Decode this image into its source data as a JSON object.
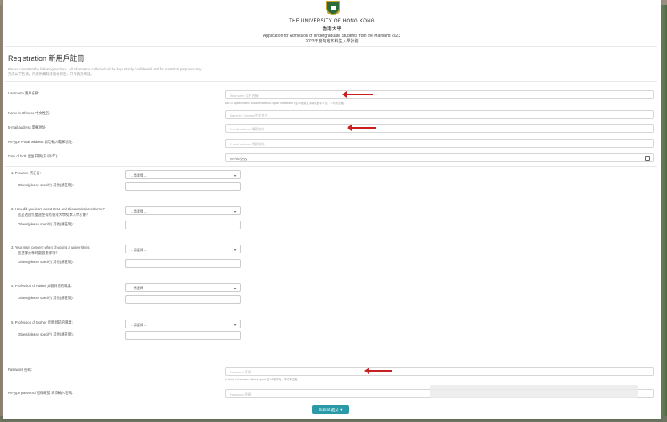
{
  "header": {
    "university": "THE UNIVERSITY OF HONG KONG",
    "university_zh": "香港大學",
    "application_title": "Application for Admission of Undergraduate Students from the Mainland 2023",
    "application_title_zh": "2023年度內地本科生入學計劃"
  },
  "form": {
    "title": "Registration 新用戶註冊",
    "intro_en": "Please complete the following sections. All information collected will be kept strictly confidential and for statistical purposes only.",
    "intro_zh": "完成以下各項，所提供資料將嚴格保密，只作統計用途。",
    "username": {
      "label": "Username 用戶名稱:",
      "placeholder": "Username 用戶名稱",
      "hint": "6 to 20 alphanumeric characters without space in-between 6至20個英文字母或數字字元，不可有空格。"
    },
    "name_chinese": {
      "label": "Name in Chinese 中文姓名:",
      "placeholder": "Name in Chinese 中文姓名"
    },
    "email": {
      "label": "E-mail address 電郵地址:",
      "placeholder": "E-mail address 電郵地址"
    },
    "email_retype": {
      "label": "Re-type e-mail address 再次輸入電郵地址:",
      "placeholder": "E-mail address 電郵地址"
    },
    "dob": {
      "label": "Date of birth 出生日期 (日/月/年):",
      "placeholder": "mm/dd/yyyy"
    },
    "select_placeholder": "-- 請選擇 --",
    "others_label": "Others(please specify) 其他(請註明):",
    "questions": [
      {
        "label": "1.  Province 所在省:"
      },
      {
        "label": "2.  How did you learn about HKU and this admission scheme?",
        "label_zh": "您是透過什麼途徑得悉香港大學及本入學計劃？"
      },
      {
        "label": "3.  Your main concern when choosing a university is:",
        "label_zh": "您選擇大學時最著重哪項？"
      },
      {
        "label": "4.  Profession of Father 父親目前的職業:"
      },
      {
        "label": "5.  Profession of Mother 母親目前的職業:"
      }
    ],
    "password": {
      "label": "Password 密碼:",
      "placeholder": "Password 密碼",
      "hint": "At least 8 characters without space 至少8個字元，不可有空格。"
    },
    "password_retype": {
      "label": "Re-type password 密碼確認 再次輸入密碼:",
      "placeholder": "Password 密碼"
    },
    "submit_label": "Submit 遞交",
    "submit_arrow": "➔"
  },
  "colors": {
    "accent": "#2a9aa8",
    "annotation_arrow": "#c82020",
    "crest_green": "#2e6b3a"
  },
  "icons": {
    "calendar": "calendar-icon",
    "chevron": "chevron-down-icon"
  }
}
